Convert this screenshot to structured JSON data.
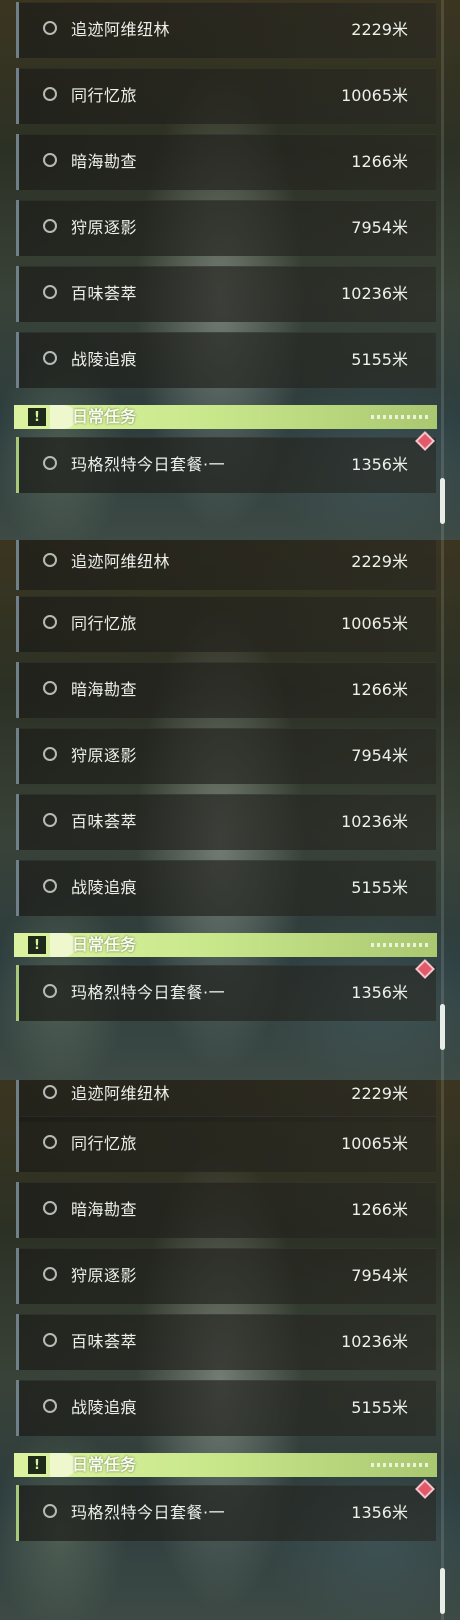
{
  "panels": [
    {
      "quests": [
        {
          "name": "追迹阿维纽林",
          "distance": "2229米"
        },
        {
          "name": "同行忆旅",
          "distance": "10065米"
        },
        {
          "name": "暗海勘查",
          "distance": "1266米"
        },
        {
          "name": "狩原逐影",
          "distance": "7954米"
        },
        {
          "name": "百味荟萃",
          "distance": "10236米"
        },
        {
          "name": "战陵追痕",
          "distance": "5155米"
        }
      ],
      "daily_header": {
        "title": "日常任务",
        "icon": "exclamation-icon"
      },
      "daily_quests": [
        {
          "name": "玛格烈特今日套餐·一",
          "distance": "1356米",
          "tracked_marker": "diamond-marker-icon"
        }
      ]
    },
    {
      "quests": [
        {
          "name": "追迹阿维纽林",
          "distance": "2229米"
        },
        {
          "name": "同行忆旅",
          "distance": "10065米"
        },
        {
          "name": "暗海勘查",
          "distance": "1266米"
        },
        {
          "name": "狩原逐影",
          "distance": "7954米"
        },
        {
          "name": "百味荟萃",
          "distance": "10236米"
        },
        {
          "name": "战陵追痕",
          "distance": "5155米"
        }
      ],
      "daily_header": {
        "title": "日常任务",
        "icon": "exclamation-icon"
      },
      "daily_quests": [
        {
          "name": "玛格烈特今日套餐·一",
          "distance": "1356米",
          "tracked_marker": "diamond-marker-icon"
        }
      ]
    },
    {
      "quests": [
        {
          "name": "追迹阿维纽林",
          "distance": "2229米"
        },
        {
          "name": "同行忆旅",
          "distance": "10065米"
        },
        {
          "name": "暗海勘查",
          "distance": "1266米"
        },
        {
          "name": "狩原逐影",
          "distance": "7954米"
        },
        {
          "name": "百味荟萃",
          "distance": "10236米"
        },
        {
          "name": "战陵追痕",
          "distance": "5155米"
        }
      ],
      "daily_header": {
        "title": "日常任务",
        "icon": "exclamation-icon"
      },
      "daily_quests": [
        {
          "name": "玛格烈特今日套餐·一",
          "distance": "1356米",
          "tracked_marker": "diamond-marker-icon"
        }
      ]
    }
  ],
  "colors": {
    "accent_green": "#c9e88c",
    "quest_bar": "#6f8088",
    "daily_bar": "#a8c97a",
    "marker_red": "#e25a6a"
  }
}
